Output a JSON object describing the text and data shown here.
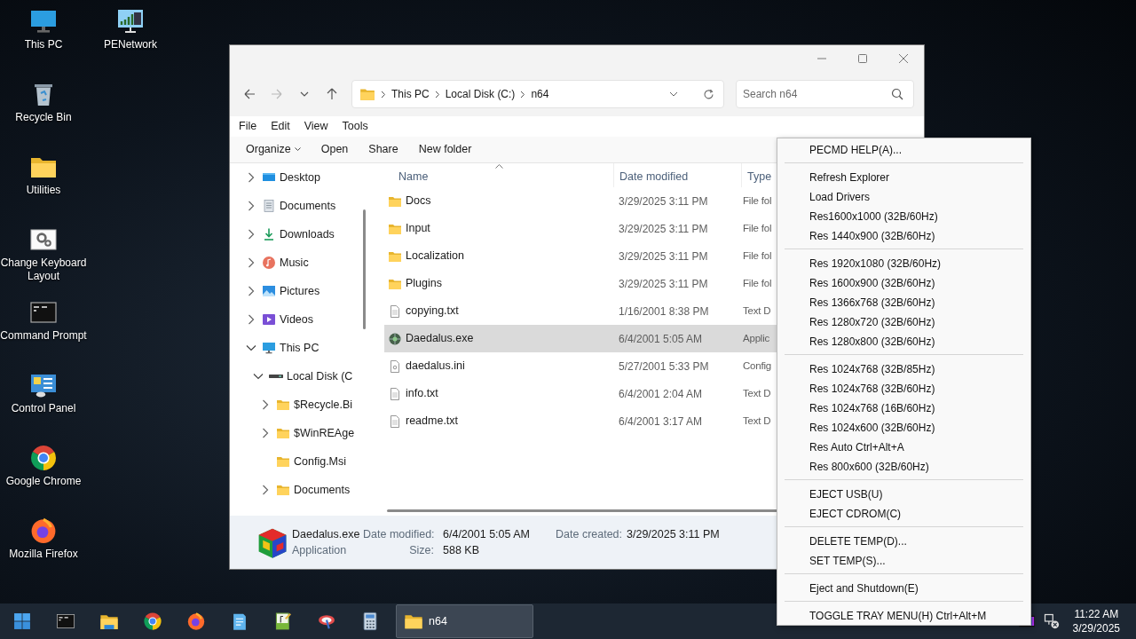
{
  "desktop_icons": [
    {
      "label": "This PC",
      "kind": "pc"
    },
    {
      "label": "Recycle Bin",
      "kind": "recycle"
    },
    {
      "label": "Utilities",
      "kind": "folder"
    },
    {
      "label": "Change Keyboard Layout",
      "kind": "gears"
    },
    {
      "label": "Command Prompt",
      "kind": "terminal"
    },
    {
      "label": "Control Panel",
      "kind": "control"
    },
    {
      "label": "Google Chrome",
      "kind": "chrome"
    },
    {
      "label": "Mozilla Firefox",
      "kind": "firefox"
    },
    {
      "label": "PENetwork",
      "kind": "network"
    }
  ],
  "explorer": {
    "nav_buttons": [
      {
        "kind": "back",
        "disabled": false
      },
      {
        "kind": "forward",
        "disabled": true
      },
      {
        "kind": "recent",
        "disabled": false
      },
      {
        "kind": "up",
        "disabled": false
      }
    ],
    "breadcrumb": [
      "This PC",
      "Local Disk (C:)",
      "n64"
    ],
    "search": {
      "placeholder": "Search n64"
    },
    "menu_bar": [
      "File",
      "Edit",
      "View",
      "Tools"
    ],
    "commands": [
      {
        "label": "Organize",
        "dropdown": true
      },
      {
        "label": "Open",
        "dropdown": false
      },
      {
        "label": "Share",
        "dropdown": false
      },
      {
        "label": "New folder",
        "dropdown": false
      }
    ],
    "nav_tree": [
      {
        "label": "Desktop",
        "kind": "desktop",
        "expandable": true,
        "expanded": false
      },
      {
        "label": "Documents",
        "kind": "documents",
        "expandable": true,
        "expanded": false
      },
      {
        "label": "Downloads",
        "kind": "downloads",
        "expandable": true,
        "expanded": false
      },
      {
        "label": "Music",
        "kind": "music",
        "expandable": true,
        "expanded": false
      },
      {
        "label": "Pictures",
        "kind": "pictures",
        "expandable": true,
        "expanded": false
      },
      {
        "label": "Videos",
        "kind": "videos",
        "expandable": true,
        "expanded": false
      },
      {
        "label": "This PC",
        "kind": "pc",
        "expandable": true,
        "expanded": true,
        "children": [
          {
            "label": "Local Disk (C",
            "kind": "drive",
            "expandable": true,
            "expanded": true,
            "children": [
              {
                "label": "$Recycle.Bi",
                "kind": "folder",
                "expandable": true,
                "expanded": false
              },
              {
                "label": "$WinREAge",
                "kind": "folder",
                "expandable": true,
                "expanded": false
              },
              {
                "label": "Config.Msi",
                "kind": "folder",
                "expandable": false
              },
              {
                "label": "Documents",
                "kind": "folder",
                "expandable": true,
                "expanded": false
              }
            ]
          }
        ]
      }
    ],
    "columns": [
      {
        "label": "Name",
        "sorted": true
      },
      {
        "label": "Date modified",
        "sorted": false
      },
      {
        "label": "Type",
        "sorted": false
      }
    ],
    "files": [
      {
        "name": "Docs",
        "kind": "folder",
        "date": "3/29/2025 3:11 PM",
        "type": "File fol",
        "selected": false
      },
      {
        "name": "Input",
        "kind": "folder",
        "date": "3/29/2025 3:11 PM",
        "type": "File fol",
        "selected": false
      },
      {
        "name": "Localization",
        "kind": "folder",
        "date": "3/29/2025 3:11 PM",
        "type": "File fol",
        "selected": false
      },
      {
        "name": "Plugins",
        "kind": "folder",
        "date": "3/29/2025 3:11 PM",
        "type": "File fol",
        "selected": false
      },
      {
        "name": "copying.txt",
        "kind": "text",
        "date": "1/16/2001 8:38 PM",
        "type": "Text D",
        "selected": false
      },
      {
        "name": "Daedalus.exe",
        "kind": "exe",
        "date": "6/4/2001 5:05 AM",
        "type": "Applic",
        "selected": true
      },
      {
        "name": "daedalus.ini",
        "kind": "config",
        "date": "5/27/2001 5:33 PM",
        "type": "Config",
        "selected": false
      },
      {
        "name": "info.txt",
        "kind": "text",
        "date": "6/4/2001 2:04 AM",
        "type": "Text D",
        "selected": false
      },
      {
        "name": "readme.txt",
        "kind": "text",
        "date": "6/4/2001 3:17 AM",
        "type": "Text D",
        "selected": false
      }
    ],
    "details": {
      "name": "Daedalus.exe",
      "type": "Application",
      "fields": [
        {
          "label": "Date modified:",
          "value": "6/4/2001 5:05 AM"
        },
        {
          "label": "Date created:",
          "value": "3/29/2025 3:11 PM"
        },
        {
          "label": "Size:",
          "value": "588 KB"
        }
      ]
    }
  },
  "tray_menu": {
    "sections": [
      [
        "PECMD HELP(A)..."
      ],
      [
        "Refresh Explorer",
        "Load Drivers",
        "Res1600x1000 (32B/60Hz)",
        "Res 1440x900 (32B/60Hz)"
      ],
      [
        "Res 1920x1080 (32B/60Hz)",
        "Res 1600x900 (32B/60Hz)",
        "Res 1366x768 (32B/60Hz)",
        "Res 1280x720 (32B/60Hz)",
        "Res 1280x800 (32B/60Hz)"
      ],
      [
        "Res 1024x768 (32B/85Hz)",
        "Res 1024x768 (32B/60Hz)",
        "Res 1024x768 (16B/60Hz)",
        "Res 1024x600 (32B/60Hz)",
        "Res Auto Ctrl+Alt+A",
        "Res 800x600 (32B/60Hz)"
      ],
      [
        "EJECT USB(U)",
        "EJECT CDROM(C)"
      ],
      [
        "DELETE TEMP(D)...",
        "SET TEMP(S)..."
      ],
      [
        "Eject and Shutdown(E)"
      ],
      [
        "TOGGLE TRAY MENU(H) Ctrl+Alt+M"
      ]
    ]
  },
  "taskbar": {
    "apps": [
      {
        "kind": "start"
      },
      {
        "kind": "terminal"
      },
      {
        "kind": "explorer"
      },
      {
        "kind": "chrome"
      },
      {
        "kind": "firefox"
      },
      {
        "kind": "notepad"
      },
      {
        "kind": "editor"
      },
      {
        "kind": "tool"
      },
      {
        "kind": "calculator"
      }
    ],
    "windows": [
      {
        "label": "n64",
        "selected": true
      }
    ],
    "tray": [
      {
        "kind": "colors"
      },
      {
        "kind": "network-off"
      }
    ],
    "clock": {
      "time": "11:22 AM",
      "date": "3/29/2025"
    }
  }
}
